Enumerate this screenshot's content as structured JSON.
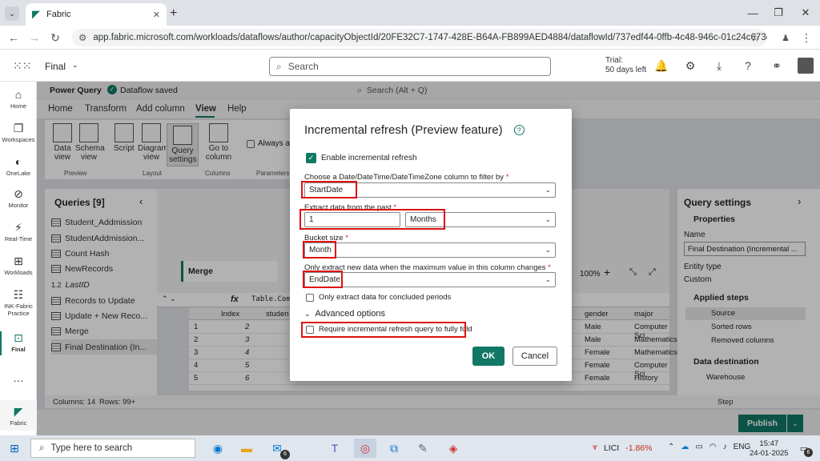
{
  "browser": {
    "tab_title": "Fabric",
    "url": "app.fabric.microsoft.com/workloads/dataflows/author/capacityObjectId/20FE32C7-1747-428E-B64A-FB899AED4884/dataflowId/737edf44-0ffb-4c48-946c-01c24c673c79/ext..."
  },
  "header": {
    "workspace": "Final",
    "search_placeholder": "Search",
    "trial_line1": "Trial:",
    "trial_line2": "50 days left"
  },
  "left_nav": [
    {
      "label": "Home",
      "icon": "home-icon"
    },
    {
      "label": "Workspaces",
      "icon": "workspaces-icon"
    },
    {
      "label": "OneLake",
      "icon": "onelake-icon"
    },
    {
      "label": "Monitor",
      "icon": "monitor-icon"
    },
    {
      "label": "Real-Time",
      "icon": "realtime-icon"
    },
    {
      "label": "Workloads",
      "icon": "workloads-icon"
    },
    {
      "label": "INK-Fabric Practice",
      "icon": "workspace-icon"
    },
    {
      "label": "Final",
      "icon": "dataflow-icon"
    },
    {
      "label": "Fabric",
      "icon": "fabric-icon"
    }
  ],
  "power_query": {
    "title": "Power Query",
    "saved_status": "Dataflow saved",
    "search_placeholder": "Search (Alt + Q)",
    "tabs": [
      "Home",
      "Transform",
      "Add column",
      "View",
      "Help"
    ],
    "ribbon": {
      "buttons": [
        "Data view",
        "Schema view",
        "Script",
        "Diagram view",
        "Query settings",
        "Go to column"
      ],
      "groups": [
        "Preview",
        "Layout",
        "Columns",
        "Parameters"
      ],
      "always_label": "Always al"
    }
  },
  "queries": {
    "title": "Queries [9]",
    "items": [
      "Student_Addmission",
      "StudentAddmission...",
      "Count Hash",
      "NewRecords",
      "LastID",
      "Records to Update",
      "Update + New Reco...",
      "Merge",
      "Final Destination (In..."
    ]
  },
  "canvas": {
    "node": "Merge",
    "zoom": "100%",
    "formula": "Table.Com"
  },
  "grid": {
    "headers": [
      "Index",
      "studen",
      "gender",
      "major"
    ],
    "rows": [
      {
        "n": "1",
        "index": "2",
        "gender": "Male",
        "major": "Computer Sci"
      },
      {
        "n": "2",
        "index": "3",
        "gender": "Male",
        "major": "Mathematics"
      },
      {
        "n": "3",
        "index": "4",
        "gender": "Female",
        "major": "Mathematics"
      },
      {
        "n": "4",
        "index": "5",
        "gender": "Female",
        "major": "Computer Sci"
      },
      {
        "n": "5",
        "index": "6",
        "gender": "Female",
        "major": "History"
      }
    ]
  },
  "query_settings": {
    "title": "Query settings",
    "properties": "Properties",
    "name_label": "Name",
    "name_value": "Final Destination (Incremental ...",
    "entity_type_label": "Entity type",
    "entity_type_value": "Custom",
    "applied_steps_label": "Applied steps",
    "steps": [
      "Source",
      "Sorted rows",
      "Removed columns"
    ],
    "data_destination_label": "Data destination",
    "destination": "Warehouse"
  },
  "status": {
    "columns": "Columns: 14",
    "rows": "Rows: 99+",
    "step": "Step",
    "publish": "Publish"
  },
  "dialog": {
    "title": "Incremental refresh (Preview feature)",
    "enable_label": "Enable incremental refresh",
    "enable_checked": true,
    "filter_column_label": "Choose a Date/DateTime/DateTimeZone column to filter by",
    "filter_column_value": "StartDate",
    "extract_label": "Extract data from the past",
    "extract_number": "1",
    "extract_unit": "Months",
    "bucket_label": "Bucket size",
    "bucket_value": "Month",
    "max_change_label": "Only extract new data when the maximum value in this column changes",
    "max_change_value": "EndDate",
    "concluded_label": "Only extract data for concluded periods",
    "advanced_label": "Advanced options",
    "fold_label": "Require incremental refresh query to fully fold",
    "ok": "OK",
    "cancel": "Cancel",
    "required_mark": "*"
  },
  "taskbar": {
    "search_placeholder": "Type here to search",
    "stock_name": "LICI",
    "stock_change": "-1.86%",
    "language": "ENG",
    "time": "15:47",
    "date": "24-01-2025",
    "notification_count": "6",
    "mail_badge": "6"
  },
  "colors": {
    "accent": "#117865",
    "highlight": "#d11111",
    "negative": "#c42b1c"
  }
}
